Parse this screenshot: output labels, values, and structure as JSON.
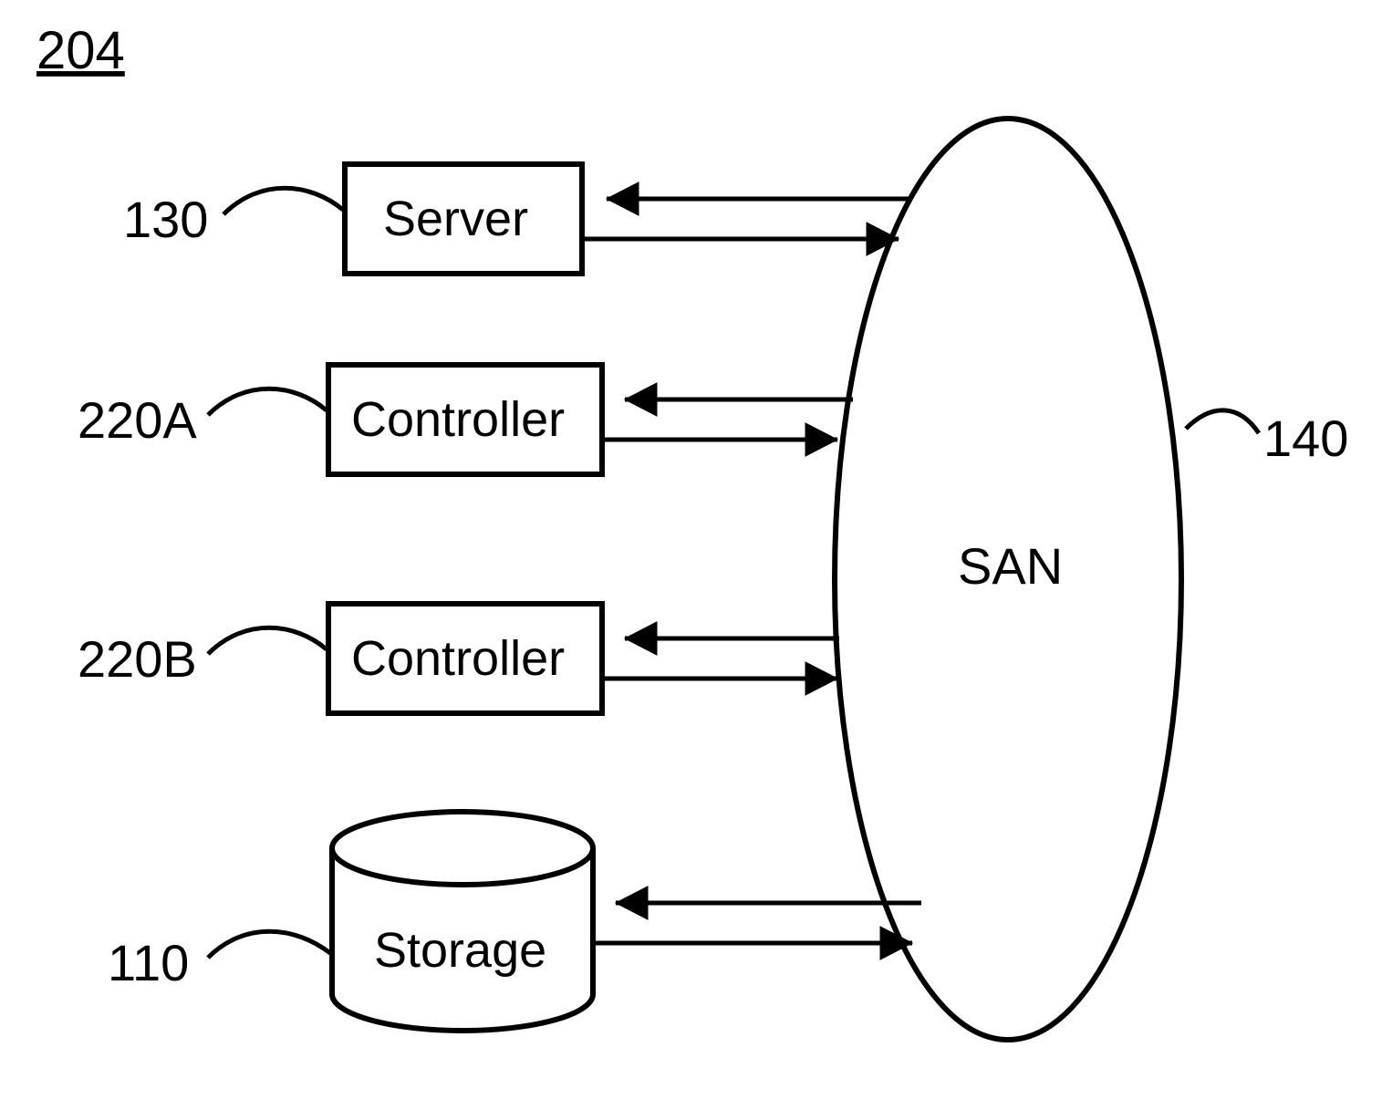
{
  "figure_ref": "204",
  "labels": {
    "server_ref": "130",
    "controllerA_ref": "220A",
    "controllerB_ref": "220B",
    "storage_ref": "110",
    "san_ref": "140"
  },
  "boxes": {
    "server": "Server",
    "controllerA": "Controller",
    "controllerB": "Controller",
    "storage": "Storage",
    "san": "SAN"
  }
}
